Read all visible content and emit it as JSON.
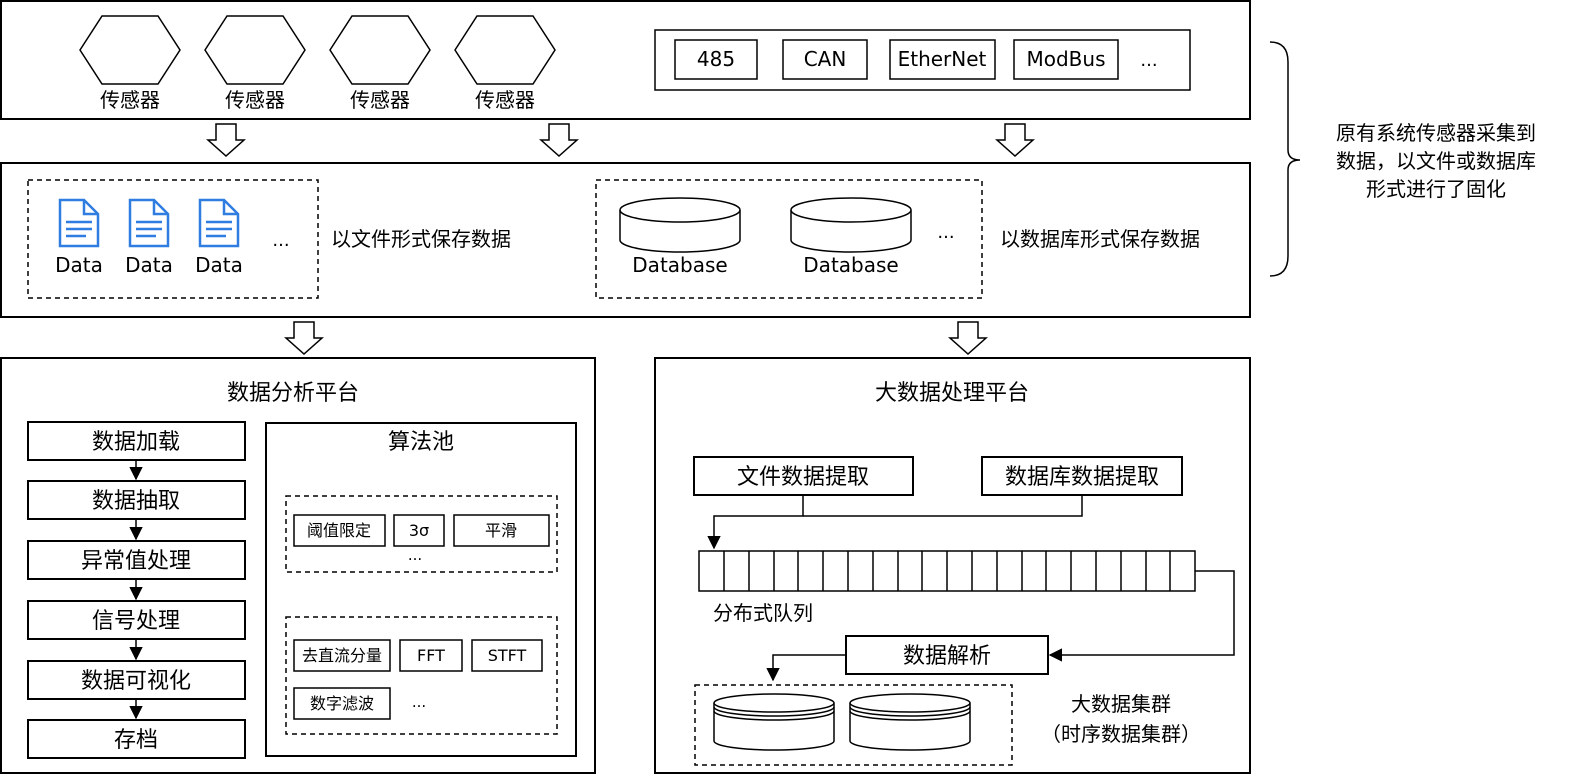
{
  "sources": {
    "sensor_label": "传感器",
    "protocols": [
      "485",
      "CAN",
      "EtherNet",
      "ModBus",
      "..."
    ]
  },
  "storage": {
    "file_label": "Data",
    "file_more": "...",
    "file_caption": "以文件形式保存数据",
    "db_label": "Database",
    "db_more": "...",
    "db_caption": "以数据库形式保存数据"
  },
  "brace_note": [
    "原有系统传感器采集到",
    "数据，以文件或数据库",
    "形式进行了固化"
  ],
  "analysis": {
    "title": "数据分析平台",
    "steps": [
      "数据加载",
      "数据抽取",
      "异常值处理",
      "信号处理",
      "数据可视化",
      "存档"
    ],
    "pool_title": "算法池",
    "group1": [
      "阈值限定",
      "3σ",
      "平滑"
    ],
    "group1_more": "...",
    "group2": [
      "去直流分量",
      "FFT",
      "STFT",
      "数字滤波"
    ],
    "group2_more": "..."
  },
  "bigdata": {
    "title": "大数据处理平台",
    "file_extract": "文件数据提取",
    "db_extract": "数据库数据提取",
    "queue_label": "分布式队列",
    "parse": "数据解析",
    "cluster_label": "大数据集群",
    "cluster_sub": "（时序数据集群）"
  }
}
